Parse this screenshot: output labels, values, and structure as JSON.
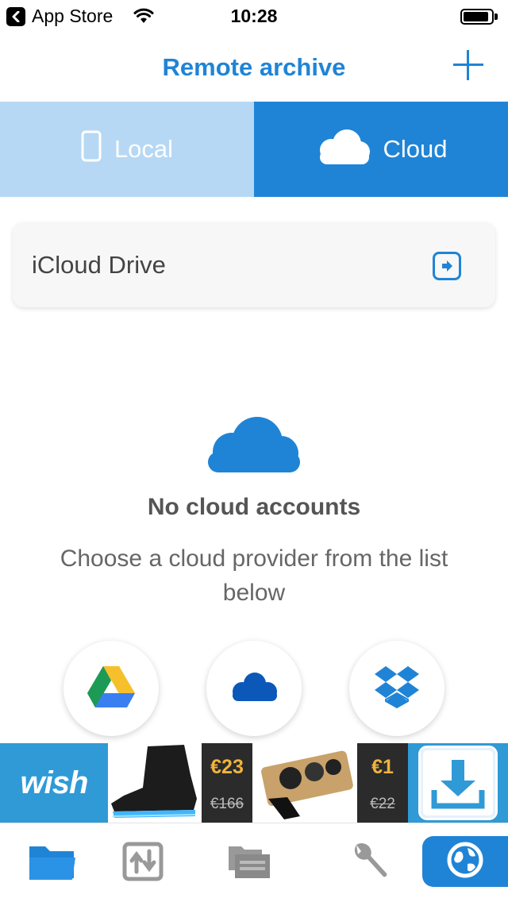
{
  "status_bar": {
    "back_app": "App Store",
    "time": "10:28",
    "battery_level": 0.9
  },
  "nav": {
    "title": "Remote archive",
    "add_icon": "plus-icon"
  },
  "segments": [
    {
      "label": "Local",
      "icon": "phone-icon",
      "selected": false
    },
    {
      "label": "Cloud",
      "icon": "cloud-icon",
      "selected": true
    }
  ],
  "icloud": {
    "label": "iCloud Drive",
    "icon": "enter-arrow-icon"
  },
  "empty_state": {
    "icon": "cloud-icon",
    "title": "No cloud accounts",
    "subtitle": "Choose a cloud provider from the list below"
  },
  "providers": [
    {
      "icon": "google-drive-icon"
    },
    {
      "icon": "onedrive-icon"
    },
    {
      "icon": "dropbox-icon"
    }
  ],
  "ad": {
    "brand": "wish",
    "offers": [
      {
        "price": "€23",
        "old_price": "€166"
      },
      {
        "price": "€1",
        "old_price": "€22"
      }
    ],
    "download_icon": "download-icon"
  },
  "tab_bar": [
    {
      "icon": "folder-icon",
      "active": true
    },
    {
      "icon": "transfer-icon",
      "active": false
    },
    {
      "icon": "archive-icon",
      "active": false
    },
    {
      "icon": "wrench-icon",
      "active": false
    },
    {
      "icon": "globe-icon",
      "active": false
    }
  ],
  "colors": {
    "accent": "#1f84d6",
    "segment_inactive": "#b6d8f4",
    "ad_blue": "#2f9ad6",
    "price_gold": "#f0b33c"
  }
}
